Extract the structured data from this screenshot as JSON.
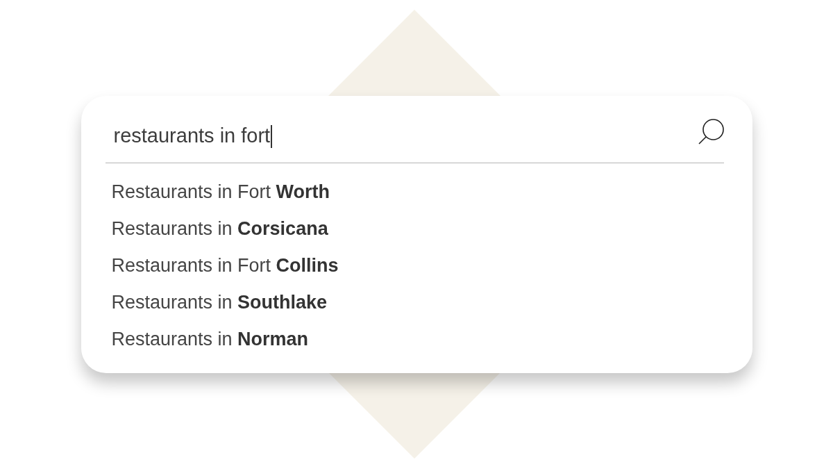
{
  "search": {
    "value": "restaurants in fort",
    "focused": true
  },
  "suggestions": [
    {
      "text": "Restaurants in Fort **Worth**",
      "selected": false
    },
    {
      "text": "Restaurants in **Corsicana**",
      "selected": false
    },
    {
      "text": "Restaurants in Fort **Collins**",
      "selected": false
    },
    {
      "text": "Restaurants in **Southlake**",
      "selected": false
    },
    {
      "text": "Restaurants in **Norman**",
      "selected": false
    }
  ]
}
